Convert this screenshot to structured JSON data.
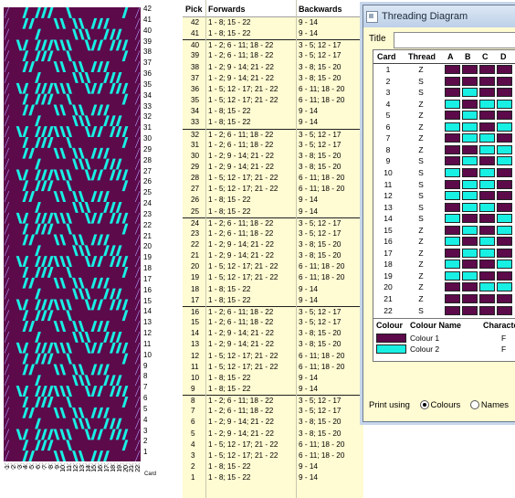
{
  "colors": {
    "colour1": "#5c0a4a",
    "colour2": "#18f0e4",
    "pick_bg": "#fffbd2",
    "window_bg": "#fffbd2"
  },
  "pattern": {
    "row_numbers": [
      "42",
      "41",
      "40",
      "39",
      "38",
      "37",
      "36",
      "35",
      "34",
      "33",
      "32",
      "31",
      "30",
      "29",
      "28",
      "27",
      "26",
      "25",
      "24",
      "23",
      "22",
      "21",
      "20",
      "19",
      "18",
      "17",
      "16",
      "15",
      "14",
      "13",
      "12",
      "11",
      "10",
      "9",
      "8",
      "7",
      "6",
      "5",
      "4",
      "3",
      "2",
      "1"
    ],
    "card_numbers": [
      "1",
      "2",
      "3",
      "4",
      "5",
      "6",
      "7",
      "8",
      "9",
      "10",
      "11",
      "12",
      "13",
      "14",
      "15",
      "16",
      "17",
      "18",
      "19",
      "20",
      "21",
      "22"
    ],
    "card_label": "Card"
  },
  "picks": {
    "headers": {
      "pick": "Pick",
      "forwards": "Forwards",
      "backwards": "Backwards"
    },
    "rows": [
      {
        "pick": "42",
        "fwd": "1 - 8; 15 - 22",
        "bwd": "9 - 14"
      },
      {
        "pick": "41",
        "fwd": "1 - 8; 15 - 22",
        "bwd": "9 - 14"
      },
      {
        "pick": "40",
        "fwd": "1 - 2; 6 - 11; 18 - 22",
        "bwd": "3 - 5; 12 - 17"
      },
      {
        "pick": "39",
        "fwd": "1 - 2; 6 - 11; 18 - 22",
        "bwd": "3 - 5; 12 - 17"
      },
      {
        "pick": "38",
        "fwd": "1 - 2; 9 - 14; 21 - 22",
        "bwd": "3 - 8; 15 - 20"
      },
      {
        "pick": "37",
        "fwd": "1 - 2; 9 - 14; 21 - 22",
        "bwd": "3 - 8; 15 - 20"
      },
      {
        "pick": "36",
        "fwd": "1 - 5; 12 - 17; 21 - 22",
        "bwd": "6 - 11; 18 - 20"
      },
      {
        "pick": "35",
        "fwd": "1 - 5; 12 - 17; 21 - 22",
        "bwd": "6 - 11; 18 - 20"
      },
      {
        "pick": "34",
        "fwd": "1 - 8; 15 - 22",
        "bwd": "9 - 14"
      },
      {
        "pick": "33",
        "fwd": "1 - 8; 15 - 22",
        "bwd": "9 - 14"
      },
      {
        "pick": "32",
        "fwd": "1 - 2; 6 - 11; 18 - 22",
        "bwd": "3 - 5; 12 - 17"
      },
      {
        "pick": "31",
        "fwd": "1 - 2; 6 - 11; 18 - 22",
        "bwd": "3 - 5; 12 - 17"
      },
      {
        "pick": "30",
        "fwd": "1 - 2; 9 - 14; 21 - 22",
        "bwd": "3 - 8; 15 - 20"
      },
      {
        "pick": "29",
        "fwd": "1 - 2; 9 - 14; 21 - 22",
        "bwd": "3 - 8; 15 - 20"
      },
      {
        "pick": "28",
        "fwd": "1 - 5; 12 - 17; 21 - 22",
        "bwd": "6 - 11; 18 - 20"
      },
      {
        "pick": "27",
        "fwd": "1 - 5; 12 - 17; 21 - 22",
        "bwd": "6 - 11; 18 - 20"
      },
      {
        "pick": "26",
        "fwd": "1 - 8; 15 - 22",
        "bwd": "9 - 14"
      },
      {
        "pick": "25",
        "fwd": "1 - 8; 15 - 22",
        "bwd": "9 - 14"
      },
      {
        "pick": "24",
        "fwd": "1 - 2; 6 - 11; 18 - 22",
        "bwd": "3 - 5; 12 - 17"
      },
      {
        "pick": "23",
        "fwd": "1 - 2; 6 - 11; 18 - 22",
        "bwd": "3 - 5; 12 - 17"
      },
      {
        "pick": "22",
        "fwd": "1 - 2; 9 - 14; 21 - 22",
        "bwd": "3 - 8; 15 - 20"
      },
      {
        "pick": "21",
        "fwd": "1 - 2; 9 - 14; 21 - 22",
        "bwd": "3 - 8; 15 - 20"
      },
      {
        "pick": "20",
        "fwd": "1 - 5; 12 - 17; 21 - 22",
        "bwd": "6 - 11; 18 - 20"
      },
      {
        "pick": "19",
        "fwd": "1 - 5; 12 - 17; 21 - 22",
        "bwd": "6 - 11; 18 - 20"
      },
      {
        "pick": "18",
        "fwd": "1 - 8; 15 - 22",
        "bwd": "9 - 14"
      },
      {
        "pick": "17",
        "fwd": "1 - 8; 15 - 22",
        "bwd": "9 - 14"
      },
      {
        "pick": "16",
        "fwd": "1 - 2; 6 - 11; 18 - 22",
        "bwd": "3 - 5; 12 - 17"
      },
      {
        "pick": "15",
        "fwd": "1 - 2; 6 - 11; 18 - 22",
        "bwd": "3 - 5; 12 - 17"
      },
      {
        "pick": "14",
        "fwd": "1 - 2; 9 - 14; 21 - 22",
        "bwd": "3 - 8; 15 - 20"
      },
      {
        "pick": "13",
        "fwd": "1 - 2; 9 - 14; 21 - 22",
        "bwd": "3 - 8; 15 - 20"
      },
      {
        "pick": "12",
        "fwd": "1 - 5; 12 - 17; 21 - 22",
        "bwd": "6 - 11; 18 - 20"
      },
      {
        "pick": "11",
        "fwd": "1 - 5; 12 - 17; 21 - 22",
        "bwd": "6 - 11; 18 - 20"
      },
      {
        "pick": "10",
        "fwd": "1 - 8; 15 - 22",
        "bwd": "9 - 14"
      },
      {
        "pick": "9",
        "fwd": "1 - 8; 15 - 22",
        "bwd": "9 - 14"
      },
      {
        "pick": "8",
        "fwd": "1 - 2; 6 - 11; 18 - 22",
        "bwd": "3 - 5; 12 - 17"
      },
      {
        "pick": "7",
        "fwd": "1 - 2; 6 - 11; 18 - 22",
        "bwd": "3 - 5; 12 - 17"
      },
      {
        "pick": "6",
        "fwd": "1 - 2; 9 - 14; 21 - 22",
        "bwd": "3 - 8; 15 - 20"
      },
      {
        "pick": "5",
        "fwd": "1 - 2; 9 - 14; 21 - 22",
        "bwd": "3 - 8; 15 - 20"
      },
      {
        "pick": "4",
        "fwd": "1 - 5; 12 - 17; 21 - 22",
        "bwd": "6 - 11; 18 - 20"
      },
      {
        "pick": "3",
        "fwd": "1 - 5; 12 - 17; 21 - 22",
        "bwd": "6 - 11; 18 - 20"
      },
      {
        "pick": "2",
        "fwd": "1 - 8; 15 - 22",
        "bwd": "9 - 14"
      },
      {
        "pick": "1",
        "fwd": "1 - 8; 15 - 22",
        "bwd": "9 - 14"
      }
    ]
  },
  "threading_window": {
    "title": "Threading Diagram",
    "title_label": "Title",
    "title_value": "",
    "card_table": {
      "headers": [
        "Card",
        "Thread",
        "A",
        "B",
        "C",
        "D"
      ],
      "rows": [
        {
          "card": "1",
          "thread": "Z",
          "holes": [
            1,
            1,
            1,
            1
          ]
        },
        {
          "card": "2",
          "thread": "S",
          "holes": [
            1,
            1,
            1,
            1
          ]
        },
        {
          "card": "3",
          "thread": "S",
          "holes": [
            1,
            2,
            1,
            1
          ]
        },
        {
          "card": "4",
          "thread": "Z",
          "holes": [
            2,
            1,
            2,
            2
          ]
        },
        {
          "card": "5",
          "thread": "Z",
          "holes": [
            1,
            2,
            1,
            1
          ]
        },
        {
          "card": "6",
          "thread": "Z",
          "holes": [
            2,
            2,
            1,
            2
          ]
        },
        {
          "card": "7",
          "thread": "Z",
          "holes": [
            1,
            2,
            2,
            1
          ]
        },
        {
          "card": "8",
          "thread": "Z",
          "holes": [
            1,
            1,
            2,
            2
          ]
        },
        {
          "card": "9",
          "thread": "S",
          "holes": [
            1,
            2,
            1,
            2
          ]
        },
        {
          "card": "10",
          "thread": "S",
          "holes": [
            2,
            1,
            2,
            1
          ]
        },
        {
          "card": "11",
          "thread": "S",
          "holes": [
            1,
            2,
            2,
            1
          ]
        },
        {
          "card": "12",
          "thread": "S",
          "holes": [
            2,
            2,
            1,
            1
          ]
        },
        {
          "card": "13",
          "thread": "S",
          "holes": [
            1,
            2,
            2,
            1
          ]
        },
        {
          "card": "14",
          "thread": "S",
          "holes": [
            2,
            1,
            1,
            2
          ]
        },
        {
          "card": "15",
          "thread": "Z",
          "holes": [
            1,
            2,
            1,
            2
          ]
        },
        {
          "card": "16",
          "thread": "Z",
          "holes": [
            2,
            1,
            2,
            1
          ]
        },
        {
          "card": "17",
          "thread": "Z",
          "holes": [
            1,
            2,
            2,
            1
          ]
        },
        {
          "card": "18",
          "thread": "Z",
          "holes": [
            2,
            1,
            1,
            2
          ]
        },
        {
          "card": "19",
          "thread": "Z",
          "holes": [
            2,
            2,
            1,
            1
          ]
        },
        {
          "card": "20",
          "thread": "Z",
          "holes": [
            1,
            1,
            2,
            2
          ]
        },
        {
          "card": "21",
          "thread": "Z",
          "holes": [
            1,
            1,
            1,
            1
          ]
        },
        {
          "card": "22",
          "thread": "S",
          "holes": [
            1,
            1,
            1,
            1
          ]
        }
      ]
    },
    "colour_table": {
      "headers": [
        "Colour",
        "Colour Name",
        "Character"
      ],
      "rows": [
        {
          "name": "Colour 1",
          "char": "F",
          "color": "#5c0a4a"
        },
        {
          "name": "Colour 2",
          "char": "F",
          "color": "#18f0e4"
        }
      ]
    },
    "print_label": "Print using",
    "print_options": [
      {
        "label": "Colours",
        "selected": true
      },
      {
        "label": "Names",
        "selected": false
      },
      {
        "label": "",
        "selected": false
      }
    ]
  }
}
